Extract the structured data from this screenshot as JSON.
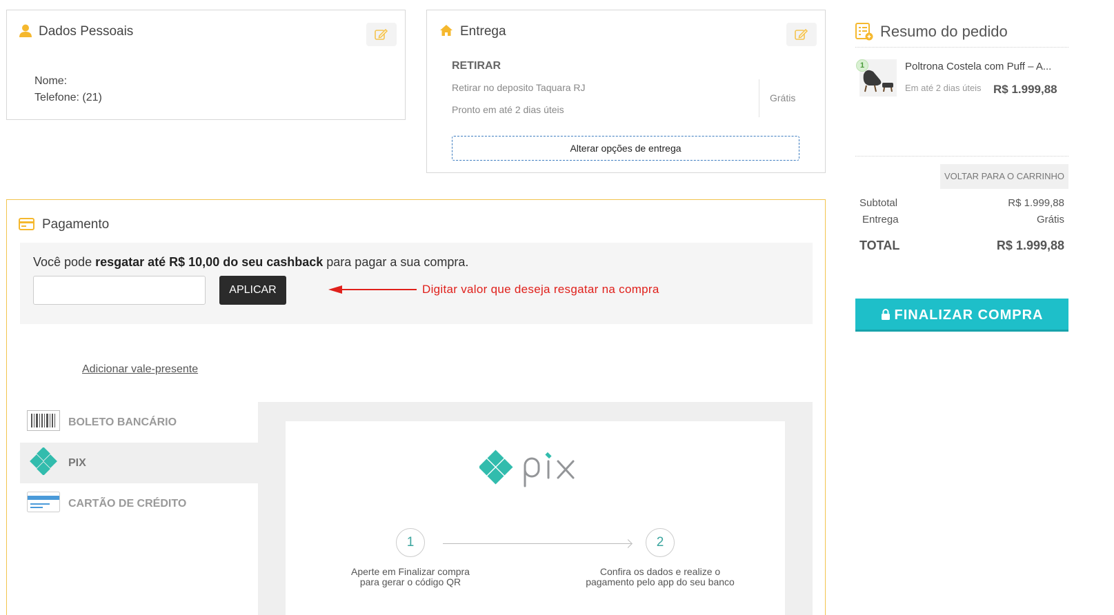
{
  "personal": {
    "title": "Dados Pessoais",
    "name_line": "Nome:",
    "phone_line": "Telefone: (21)"
  },
  "delivery": {
    "title": "Entrega",
    "type": "RETIRAR",
    "location": "Retirar no deposito Taquara RJ",
    "eta": "Pronto em até 2 dias úteis",
    "price": "Grátis",
    "change_button": "Alterar opções de entrega"
  },
  "payment": {
    "title": "Pagamento",
    "cashback": {
      "prefix": "Você pode ",
      "highlight": "resgatar até R$ 10,00 do seu cashback",
      "suffix": " para pagar a sua compra.",
      "input_value": "",
      "apply_button": "APLICAR",
      "annotation": "Digitar valor que deseja resgatar na compra"
    },
    "gift_link": "Adicionar vale-presente",
    "methods": [
      {
        "label": "BOLETO BANCÁRIO",
        "icon": "barcode-icon",
        "active": false
      },
      {
        "label": "PIX",
        "icon": "pix-icon",
        "active": true
      },
      {
        "label": "CARTÃO DE CRÉDITO",
        "icon": "credit-card-icon",
        "active": false
      }
    ],
    "pix": {
      "logo_text": "pix",
      "steps": [
        {
          "number": "1",
          "text_line1": "Aperte em Finalizar compra",
          "text_line2": "para gerar o código QR"
        },
        {
          "number": "2",
          "text_line1": "Confira os dados e realize o",
          "text_line2": "pagamento pelo app do seu banco"
        }
      ]
    }
  },
  "summary": {
    "title": "Resumo do pedido",
    "item": {
      "qty": "1",
      "name": "Poltrona Costela com Puff – A...",
      "eta": "Em até 2 dias úteis",
      "price": "R$ 1.999,88"
    },
    "back_button": "VOLTAR PARA O CARRINHO",
    "subtotal_label": "Subtotal",
    "subtotal_value": "R$ 1.999,88",
    "shipping_label": "Entrega",
    "shipping_value": "Grátis",
    "total_label": "TOTAL",
    "total_value": "R$ 1.999,88",
    "finalize_button": "FINALIZAR COMPRA"
  },
  "colors": {
    "accent_orange": "#f5b82e",
    "pix_teal": "#32bcad",
    "finalize_teal": "#1ebfc9",
    "annotation_red": "#e0201b"
  }
}
